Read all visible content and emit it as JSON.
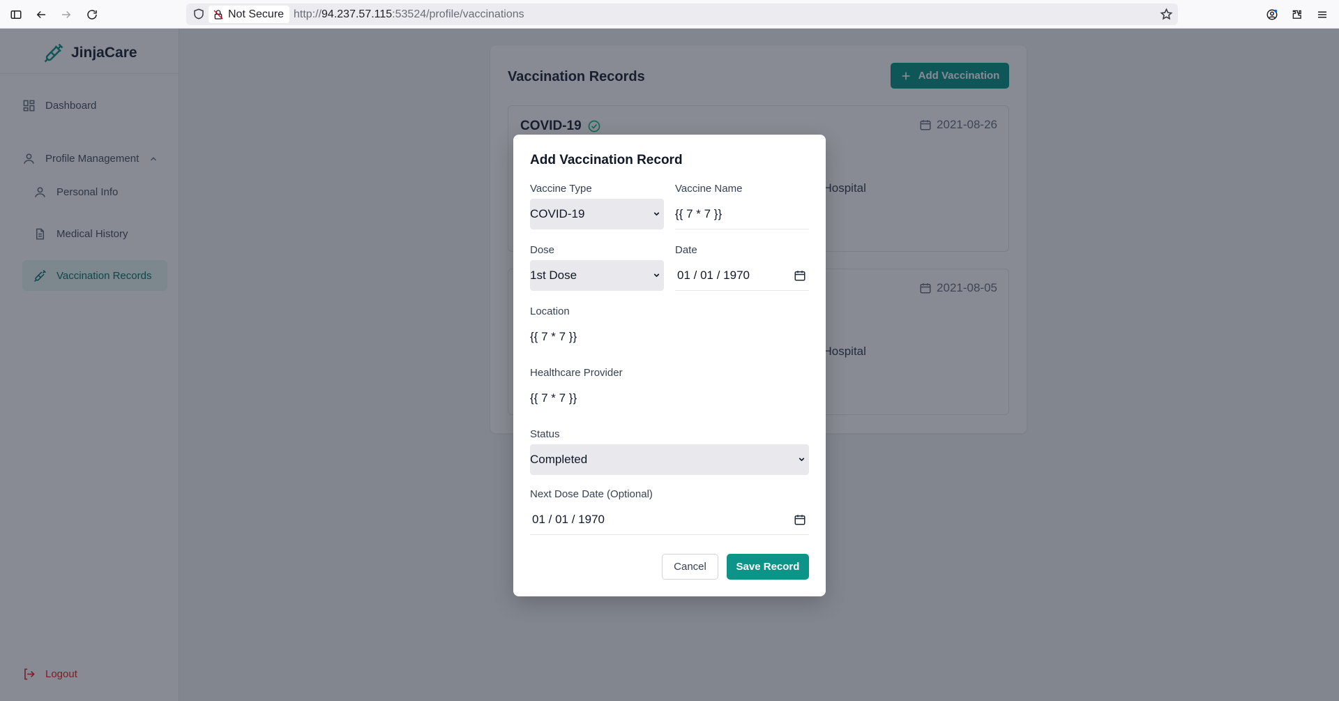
{
  "browser": {
    "security_label": "Not Secure",
    "url_prefix": "http://",
    "url_host": "94.237.57.115",
    "url_path": ":53524/profile/vaccinations"
  },
  "sidebar": {
    "brand": "JinjaCare",
    "items": [
      {
        "label": "Dashboard",
        "icon": "dashboard-icon"
      },
      {
        "label": "Profile Management",
        "icon": "user-icon"
      },
      {
        "label": "Personal Info",
        "icon": "user-icon"
      },
      {
        "label": "Medical History",
        "icon": "document-icon"
      },
      {
        "label": "Vaccination Records",
        "icon": "syringe-icon",
        "active": true
      }
    ],
    "logout": "Logout"
  },
  "main": {
    "title": "Vaccination Records",
    "add_button": "Add Vaccination",
    "records": [
      {
        "name": "COVID-19",
        "date": "2021-08-26",
        "location_fragment": "l Hospital"
      },
      {
        "name": "",
        "date": "2021-08-05",
        "location_fragment": "l Hospital"
      }
    ]
  },
  "modal": {
    "title": "Add Vaccination Record",
    "vaccine_type_label": "Vaccine Type",
    "vaccine_type_value": "COVID-19",
    "vaccine_name_label": "Vaccine Name",
    "vaccine_name_value": "{{ 7 * 7 }}",
    "dose_label": "Dose",
    "dose_value": "1st Dose",
    "date_label": "Date",
    "date_value": "01 / 01 / 1970",
    "location_label": "Location",
    "location_value": "{{ 7 * 7 }}",
    "provider_label": "Healthcare Provider",
    "provider_value": "{{ 7 * 7 }}",
    "status_label": "Status",
    "status_value": "Completed",
    "next_dose_label": "Next Dose Date (Optional)",
    "next_dose_value": "01 / 01 / 1970",
    "cancel_label": "Cancel",
    "save_label": "Save Record"
  },
  "colors": {
    "accent": "#0d9488",
    "overlay": "rgba(17,24,39,0.5)"
  }
}
